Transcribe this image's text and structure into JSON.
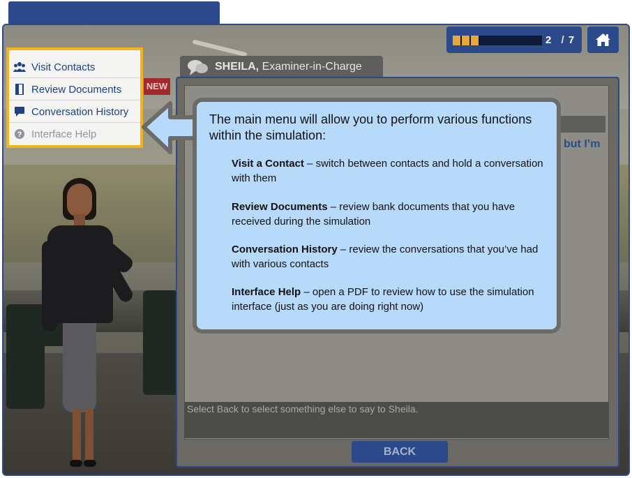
{
  "progress": {
    "current": "2",
    "separator": "/",
    "total": "7",
    "filled_segments": 3,
    "total_segments": 7
  },
  "icons": {
    "home": "home-icon",
    "speech": "speech-bubble-icon",
    "contacts": "people-icon",
    "documents": "document-icon",
    "history": "chat-icon",
    "help": "question-circle-icon"
  },
  "speaker": {
    "name": "SHEILA,",
    "role": "Examiner-in-Charge"
  },
  "badge": {
    "new_label": "NEW"
  },
  "menu": {
    "items": [
      {
        "label": "Visit Contacts"
      },
      {
        "label": "Review Documents"
      },
      {
        "label": "Conversation History"
      },
      {
        "label": "Interface Help"
      }
    ]
  },
  "callout": {
    "intro": "The main menu will allow you to perform various functions within the simulation:",
    "items": [
      {
        "title": "Visit a Contact",
        "desc": " – switch between contacts and hold a conversation with them"
      },
      {
        "title": "Review Documents",
        "desc": " – review bank documents that you have received during the simulation"
      },
      {
        "title": "Conversation History",
        "desc": " – review the conversations that you’ve had with various contacts"
      },
      {
        "title": "Interface Help",
        "desc": " – open a PDF to review how to use the simulation interface (just as you are doing right now)"
      }
    ]
  },
  "panel": {
    "snippet": "but I’m",
    "instruction": "Select Back to select something else to say to Sheila."
  },
  "back_button": {
    "label": "BACK"
  },
  "colors": {
    "brand_blue": "#2c4a8a",
    "menu_border": "#f3b41b",
    "callout_bg": "#b8dafa",
    "progress_fill": "#e8a93a",
    "new_badge": "#a02a2c"
  }
}
